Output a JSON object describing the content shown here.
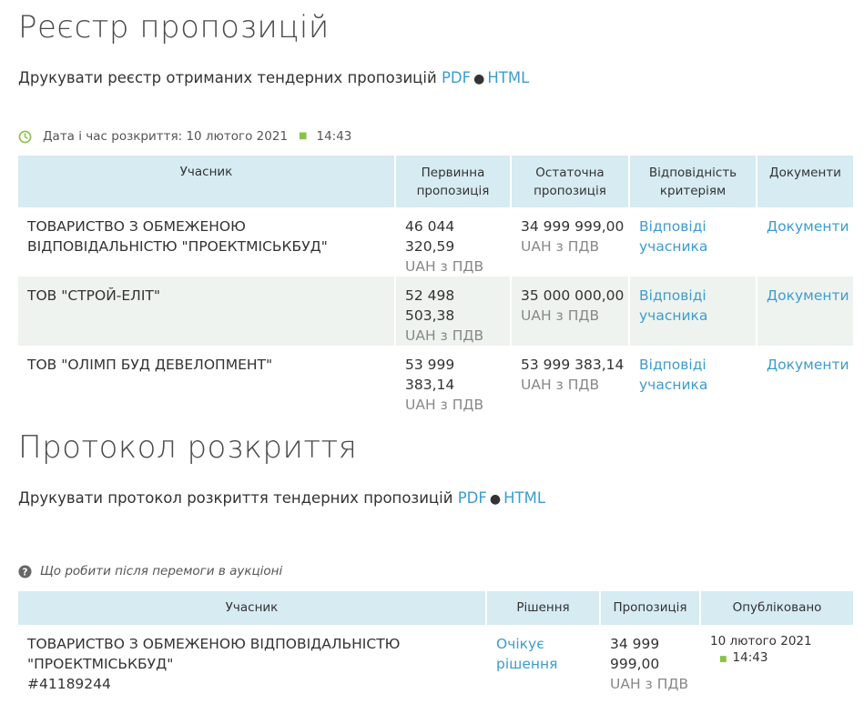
{
  "registry": {
    "title": "Реєстр пропозицій",
    "print_text": "Друкувати реєстр отриманих тендерних пропозицій",
    "pdf_label": "PDF",
    "html_label": "HTML",
    "bullet": "●",
    "opening_label": "Дата і час розкриття: 10 лютого 2021",
    "opening_time": "14:43",
    "headers": {
      "participant": "Учасник",
      "initial": "Первинна пропозиція",
      "final": "Остаточна пропозиція",
      "criteria": "Відповідність критеріям",
      "documents": "Документи"
    },
    "rows": [
      {
        "name": "ТОВАРИСТВО З ОБМЕЖЕНОЮ ВІДПОВІДАЛЬНІСТЮ \"ПРОЕКТМІСЬКБУД\"",
        "initial": "46 044 320,59",
        "initial_unit": "UAH з ПДВ",
        "final": "34 999 999,00",
        "final_unit": "UAH з ПДВ",
        "criteria_link": "Відповіді учасника",
        "docs_link": "Документи"
      },
      {
        "name": "ТОВ \"СТРОЙ-ЕЛІТ\"",
        "initial": "52 498 503,38",
        "initial_unit": "UAH з ПДВ",
        "final": "35 000 000,00",
        "final_unit": "UAH з ПДВ",
        "criteria_link": "Відповіді учасника",
        "docs_link": "Документи"
      },
      {
        "name": "ТОВ \"ОЛІМП БУД ДЕВЕЛОПМЕНТ\"",
        "initial": "53 999 383,14",
        "initial_unit": "UAH з ПДВ",
        "final": "53 999 383,14",
        "final_unit": "UAH з ПДВ",
        "criteria_link": "Відповіді учасника",
        "docs_link": "Документи"
      }
    ]
  },
  "protocol": {
    "title": "Протокол розкриття",
    "print_text": "Друкувати протокол розкриття тендерних пропозицій",
    "pdf_label": "PDF",
    "html_label": "HTML",
    "bullet": "●",
    "help_text": "Що робити після перемоги в аукціоні",
    "headers": {
      "participant": "Учасник",
      "decision": "Рішення",
      "offer": "Пропозиція",
      "published": "Опубліковано"
    },
    "row": {
      "name": "ТОВАРИСТВО З ОБМЕЖЕНОЮ ВІДПОВІДАЛЬНІСТЮ \"ПРОЕКТМІСЬКБУД\"",
      "code": "#41189244",
      "decision_link": "Очікує рішення",
      "offer": "34 999 999,00",
      "offer_unit": "UAH з ПДВ",
      "pub_date": "10 лютого 2021",
      "pub_time": "14:43"
    }
  },
  "colors": {
    "link": "#3d9ccf",
    "header_bg": "#d6ebf2",
    "alt_row_bg": "#eef3ef",
    "clock_icon": "#8bc34a"
  },
  "icons": {
    "clock": "clock-icon",
    "help": "question-circle-icon"
  }
}
